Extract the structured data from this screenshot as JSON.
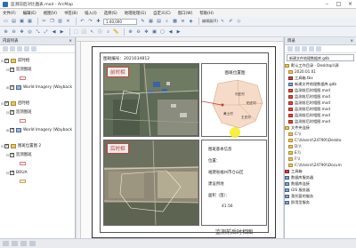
{
  "window": {
    "title": "监测前后对比图表.mxd - ArcMap",
    "controls": [
      "–",
      "□",
      "×"
    ]
  },
  "menu": [
    "文件(F)",
    "编辑(E)",
    "视图(V)",
    "书签(B)",
    "插入(I)",
    "选择(S)",
    "地理处理(G)",
    "自定义(C)",
    "窗口(W)",
    "帮助(H)"
  ],
  "toolbar": {
    "scale": "1:40,000",
    "editor_label": "编辑器(R)"
  },
  "toc": {
    "title": "内容列表",
    "close": "×",
    "layers": [
      {
        "label": "前时相",
        "kind": "frame",
        "level": 0,
        "checked": true
      },
      {
        "label": "监测图斑",
        "kind": "layer",
        "level": 1,
        "checked": true
      },
      {
        "label": "World Imagery (Wayback",
        "kind": "layer",
        "level": 1,
        "checked": true
      },
      {
        "label": "后时相",
        "kind": "frame",
        "level": 0,
        "checked": true
      },
      {
        "label": "监测图斑",
        "kind": "layer",
        "level": 1,
        "checked": true
      },
      {
        "label": "World Imagery (Wayback",
        "kind": "layer",
        "level": 1,
        "checked": true
      },
      {
        "label": "图斑位置图 2",
        "kind": "frame",
        "level": 0,
        "checked": true
      },
      {
        "label": "监测图斑",
        "kind": "layer",
        "level": 1,
        "checked": true
      },
      {
        "label": "BOUA",
        "kind": "layer",
        "level": 1,
        "checked": true
      }
    ]
  },
  "layout": {
    "map_number": "图斑编号：2021034812",
    "before_label": "前时相",
    "after_label": "后时相",
    "location_title": "图斑位置图",
    "location_places": [
      "刘庄村",
      "柏庄村",
      "黄土村",
      "王庄村"
    ],
    "info": {
      "title": "图斑基本信息",
      "location_label": "位置：",
      "location_value": "福建省福州市仓山区",
      "type_label": "建设用地",
      "area_label": "面积（亩）：",
      "area_value": "41.56"
    },
    "footer": "监测前后时相图"
  },
  "catalog": {
    "title": "目录",
    "location_value": "新建文件地理数据库.gdb",
    "items": [
      {
        "label": "默认工作目录 - Desktop\\\\源",
        "kind": "folder"
      },
      {
        "label": "2020.01.01",
        "kind": "folder"
      },
      {
        "label": "工具箱.tbx",
        "kind": "tool"
      },
      {
        "label": "新建文件地理数据库.gdb",
        "kind": "db"
      },
      {
        "label": "监测前后时相图.mxd",
        "kind": "doc"
      },
      {
        "label": "监测前后时相图.mxd",
        "kind": "doc"
      },
      {
        "label": "监测前后时相图.mxd",
        "kind": "doc"
      },
      {
        "label": "监测前后时相图.mxd",
        "kind": "doc"
      },
      {
        "label": "监测前后时相图.mxd",
        "kind": "doc"
      },
      {
        "label": "监测前后时相图.mxd",
        "kind": "doc"
      },
      {
        "label": "文件夹连接",
        "kind": "folder"
      },
      {
        "label": "C:\\\\",
        "kind": "folder"
      },
      {
        "label": "C:\\\\Users\\\\24790\\\\Deskto",
        "kind": "folder"
      },
      {
        "label": "D:\\\\",
        "kind": "folder"
      },
      {
        "label": "E:\\\\",
        "kind": "folder"
      },
      {
        "label": "F:\\\\",
        "kind": "folder"
      },
      {
        "label": "C:\\\\Users\\\\24790\\\\Docum",
        "kind": "folder"
      },
      {
        "label": "工具箱",
        "kind": "tool"
      },
      {
        "label": "数据库服务器",
        "kind": "db"
      },
      {
        "label": "数据库连接",
        "kind": "db"
      },
      {
        "label": "GIS 服务器",
        "kind": "db"
      },
      {
        "label": "我托管的服务",
        "kind": "db"
      },
      {
        "label": "即用型服务",
        "kind": "db"
      }
    ]
  }
}
